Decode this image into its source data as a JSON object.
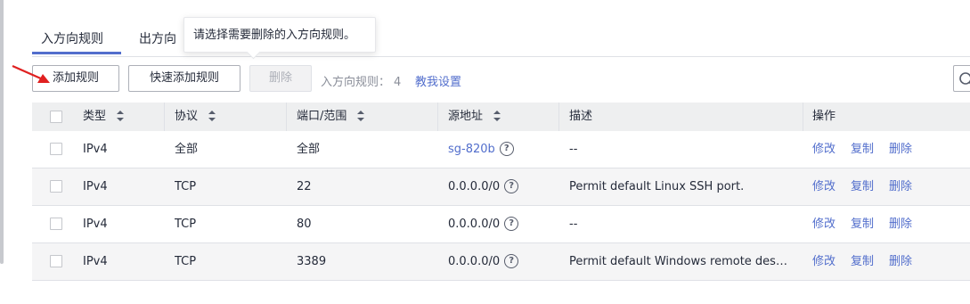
{
  "tabs": [
    {
      "label": "入方向规则",
      "active": true
    },
    {
      "label": "出方向"
    }
  ],
  "tooltip": {
    "text": "请选择需要删除的入方向规则。"
  },
  "toolbar": {
    "add_label": "添加规则",
    "quick_add_label": "快速添加规则",
    "delete_label": "删除",
    "count_label": "入方向规则：",
    "count": "4",
    "help_link": "教我设置"
  },
  "table": {
    "headers": {
      "type": "类型",
      "protocol": "协议",
      "port": "端口/范围",
      "source": "源地址",
      "desc": "描述",
      "ops": "操作"
    },
    "rows": [
      {
        "type": "IPv4",
        "protocol": "全部",
        "port": "全部",
        "source": "sg-820b",
        "source_is_link": true,
        "desc": "--",
        "edit": "修改",
        "copy": "复制",
        "delete": "删除"
      },
      {
        "type": "IPv4",
        "protocol": "TCP",
        "port": "22",
        "source": "0.0.0.0/0",
        "source_is_link": false,
        "desc": "Permit default Linux SSH port.",
        "edit": "修改",
        "copy": "复制",
        "delete": "删除"
      },
      {
        "type": "IPv4",
        "protocol": "TCP",
        "port": "80",
        "source": "0.0.0.0/0",
        "source_is_link": false,
        "desc": "--",
        "edit": "修改",
        "copy": "复制",
        "delete": "删除"
      },
      {
        "type": "IPv4",
        "protocol": "TCP",
        "port": "3389",
        "source": "0.0.0.0/0",
        "source_is_link": false,
        "desc": "Permit default Windows remote deskt...",
        "edit": "修改",
        "copy": "复制",
        "delete": "删除"
      }
    ]
  },
  "icons": {
    "help": "question-circle-icon",
    "search": "search-icon",
    "annotation": "red-arrow-icon"
  },
  "colors": {
    "accent": "#526ecc",
    "header_bg": "#eeeff0",
    "arrow": "#e02020"
  }
}
